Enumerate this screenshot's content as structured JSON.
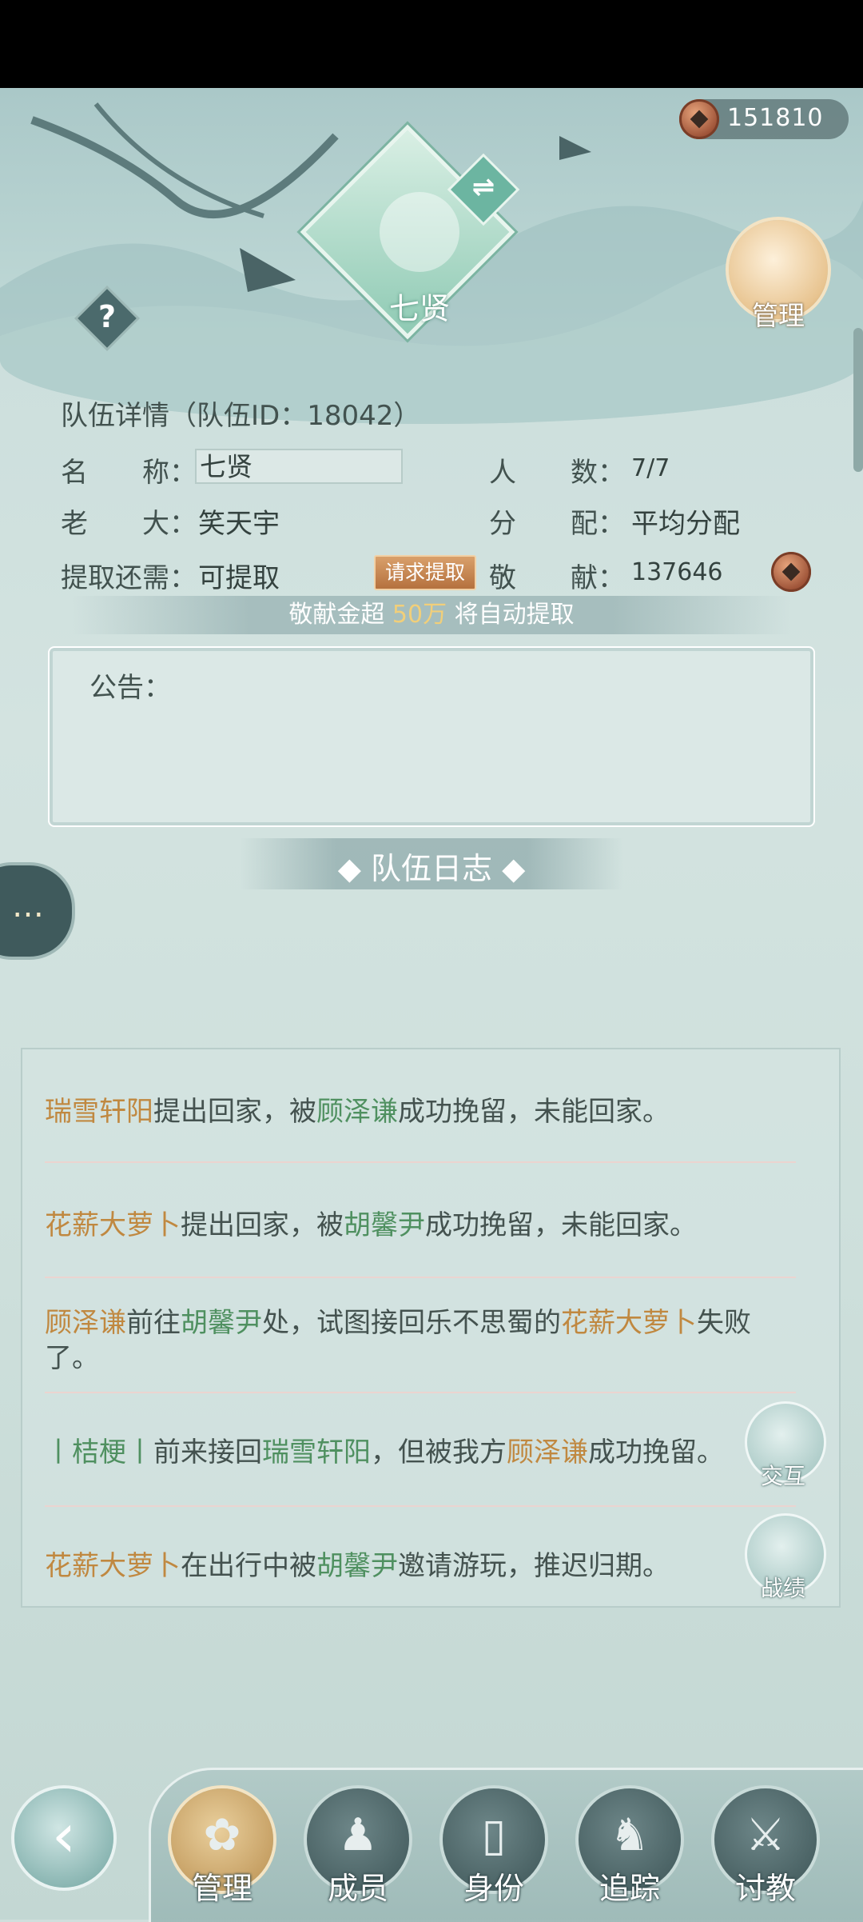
{
  "currency": {
    "icon": "copper-coin-icon",
    "value": "151810"
  },
  "header": {
    "emblem_text": "七贤",
    "swap_icon": "⇌",
    "help_icon": "?",
    "manage_label": "管理"
  },
  "team": {
    "section_title": "队伍详情（队伍ID：18042）",
    "name_label": "名　　称：",
    "name_value": "七贤",
    "members_label": "人　　数：",
    "members_value": "7/7",
    "leader_label": "老　　大：",
    "leader_value": "笑天宇",
    "distribution_label": "分　　配：",
    "distribution_value": "平均分配",
    "withdraw_label": "提取还需：",
    "withdraw_value": "可提取",
    "request_button": "请求提取",
    "contribution_label": "敬　　献：",
    "contribution_value": "137646"
  },
  "hint": {
    "prefix": "敬献金超 ",
    "amount": "50万",
    "suffix": " 将自动提取"
  },
  "notice": {
    "label": "公告："
  },
  "log": {
    "title": "◆ 队伍日志 ◆",
    "entries": [
      {
        "parts": [
          {
            "text": "瑞雪轩阳",
            "color": "orange"
          },
          {
            "text": "提出回家，被"
          },
          {
            "text": "顾泽谦",
            "color": "green"
          },
          {
            "text": "成功挽留，未能回家。"
          }
        ]
      },
      {
        "parts": [
          {
            "text": "花薪大萝卜",
            "color": "orange"
          },
          {
            "text": "提出回家，被"
          },
          {
            "text": "胡馨尹",
            "color": "green"
          },
          {
            "text": "成功挽留，未能回家。"
          }
        ]
      },
      {
        "parts": [
          {
            "text": "顾泽谦",
            "color": "orange"
          },
          {
            "text": "前往"
          },
          {
            "text": "胡馨尹",
            "color": "green"
          },
          {
            "text": "处，试图接回乐不思蜀的"
          },
          {
            "text": "花薪大萝卜",
            "color": "orange"
          },
          {
            "text": "失败了。"
          }
        ]
      },
      {
        "parts": [
          {
            "text": "丨桔梗丨",
            "color": "green"
          },
          {
            "text": "前来接回"
          },
          {
            "text": "瑞雪轩阳",
            "color": "green"
          },
          {
            "text": "，但被我方"
          },
          {
            "text": "顾泽谦",
            "color": "orange"
          },
          {
            "text": "成功挽留。"
          }
        ]
      },
      {
        "parts": [
          {
            "text": "花薪大萝卜",
            "color": "orange"
          },
          {
            "text": "在出行中被"
          },
          {
            "text": "胡馨尹",
            "color": "green"
          },
          {
            "text": "邀请游玩，推迟归期。"
          }
        ]
      }
    ]
  },
  "side_buttons": {
    "interact_label": "交互",
    "record_label": "战绩",
    "chat_icon": "…"
  },
  "bottom_nav": {
    "back_icon": "‹",
    "items": [
      {
        "label": "管理",
        "icon": "lotus-icon",
        "glyph": "✿",
        "active": true
      },
      {
        "label": "成员",
        "icon": "members-icon",
        "glyph": "♟",
        "active": false
      },
      {
        "label": "身份",
        "icon": "identity-card-icon",
        "glyph": "▯",
        "active": false
      },
      {
        "label": "追踪",
        "icon": "boot-icon",
        "glyph": "♞",
        "active": false
      },
      {
        "label": "讨教",
        "icon": "spear-icon",
        "glyph": "⚔",
        "active": false
      }
    ]
  },
  "colors": {
    "orange": "#c08840",
    "green": "#4f9060",
    "accent_gold": "#f1cf7a"
  }
}
